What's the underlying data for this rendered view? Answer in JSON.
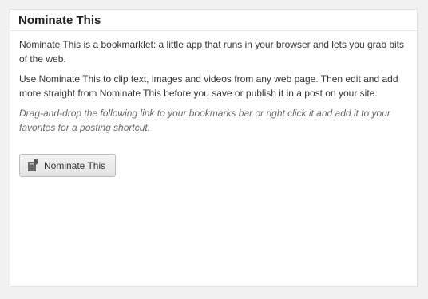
{
  "widget": {
    "title": "Nominate This",
    "paragraphs": [
      "Nominate This is a bookmarklet: a little app that runs in your browser and lets you grab bits of the web.",
      "Use Nominate This to clip text, images and videos from any web page. Then edit and add more straight from Nominate This before you save or publish it in a post on your site."
    ],
    "hint": "Drag-and-drop the following link to your bookmarks bar or right click it and add it to your favorites for a posting shortcut.",
    "button": {
      "label": "Nominate This",
      "icon": "edit-icon"
    }
  },
  "colors": {
    "page_background": "#f1f1f1",
    "panel_background": "#ffffff",
    "text": "#333333",
    "hint_text": "#666666"
  }
}
